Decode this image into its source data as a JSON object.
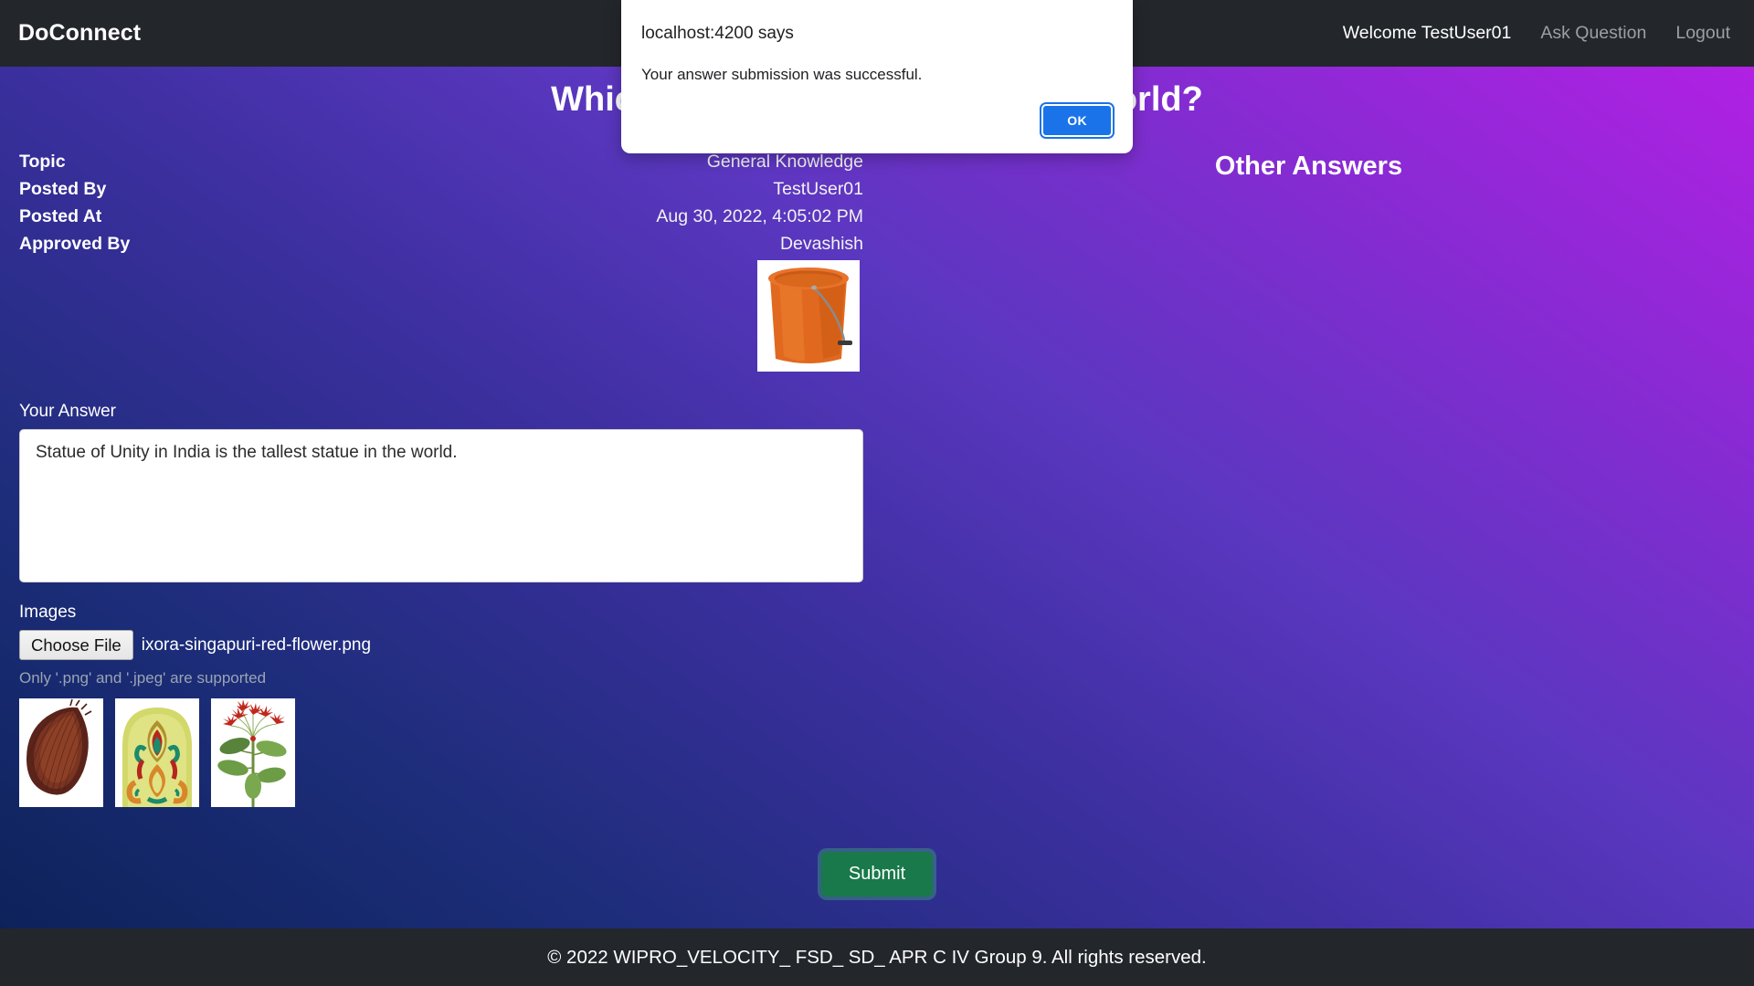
{
  "navbar": {
    "brand": "DoConnect",
    "welcome": "Welcome TestUser01",
    "ask_question": "Ask Question",
    "logout": "Logout"
  },
  "question": {
    "title": "Which is the tallest statue in the world?",
    "labels": {
      "topic": "Topic",
      "posted_by": "Posted By",
      "posted_at": "Posted At",
      "approved_by": "Approved By"
    },
    "values": {
      "topic": "General Knowledge",
      "posted_by": "TestUser01",
      "posted_at": "Aug 30, 2022, 4:05:02 PM",
      "approved_by": "Devashish"
    },
    "image_name": "orange-bucket-image"
  },
  "other_answers": {
    "title": "Other Answers"
  },
  "answer_form": {
    "answer_label": "Your Answer",
    "answer_value": "Statue of Unity in India is the tallest statue in the world.",
    "answer_placeholder": "",
    "images_label": "Images",
    "choose_file_label": "Choose File",
    "file_name": "ixora-singapuri-red-flower.png",
    "file_hint": "Only '.png' and '.jpeg' are supported",
    "thumbnails": [
      {
        "name": "coconut-seed-thumbnail"
      },
      {
        "name": "ornamental-motif-thumbnail"
      },
      {
        "name": "red-flower-plant-thumbnail"
      }
    ],
    "submit_label": "Submit"
  },
  "footer": {
    "text": "© 2022 WIPRO_VELOCITY_ FSD_ SD_ APR C IV Group 9. All rights reserved."
  },
  "alert": {
    "host": "localhost:4200 says",
    "message": "Your answer submission was successful.",
    "ok_label": "OK"
  },
  "colors": {
    "navbar_bg": "#23262b",
    "gradient_start": "#0b2156",
    "gradient_end": "#b81fe6",
    "submit_green": "#19794a",
    "ok_blue": "#1a73e8",
    "hint_grey": "#9aa4b4"
  }
}
